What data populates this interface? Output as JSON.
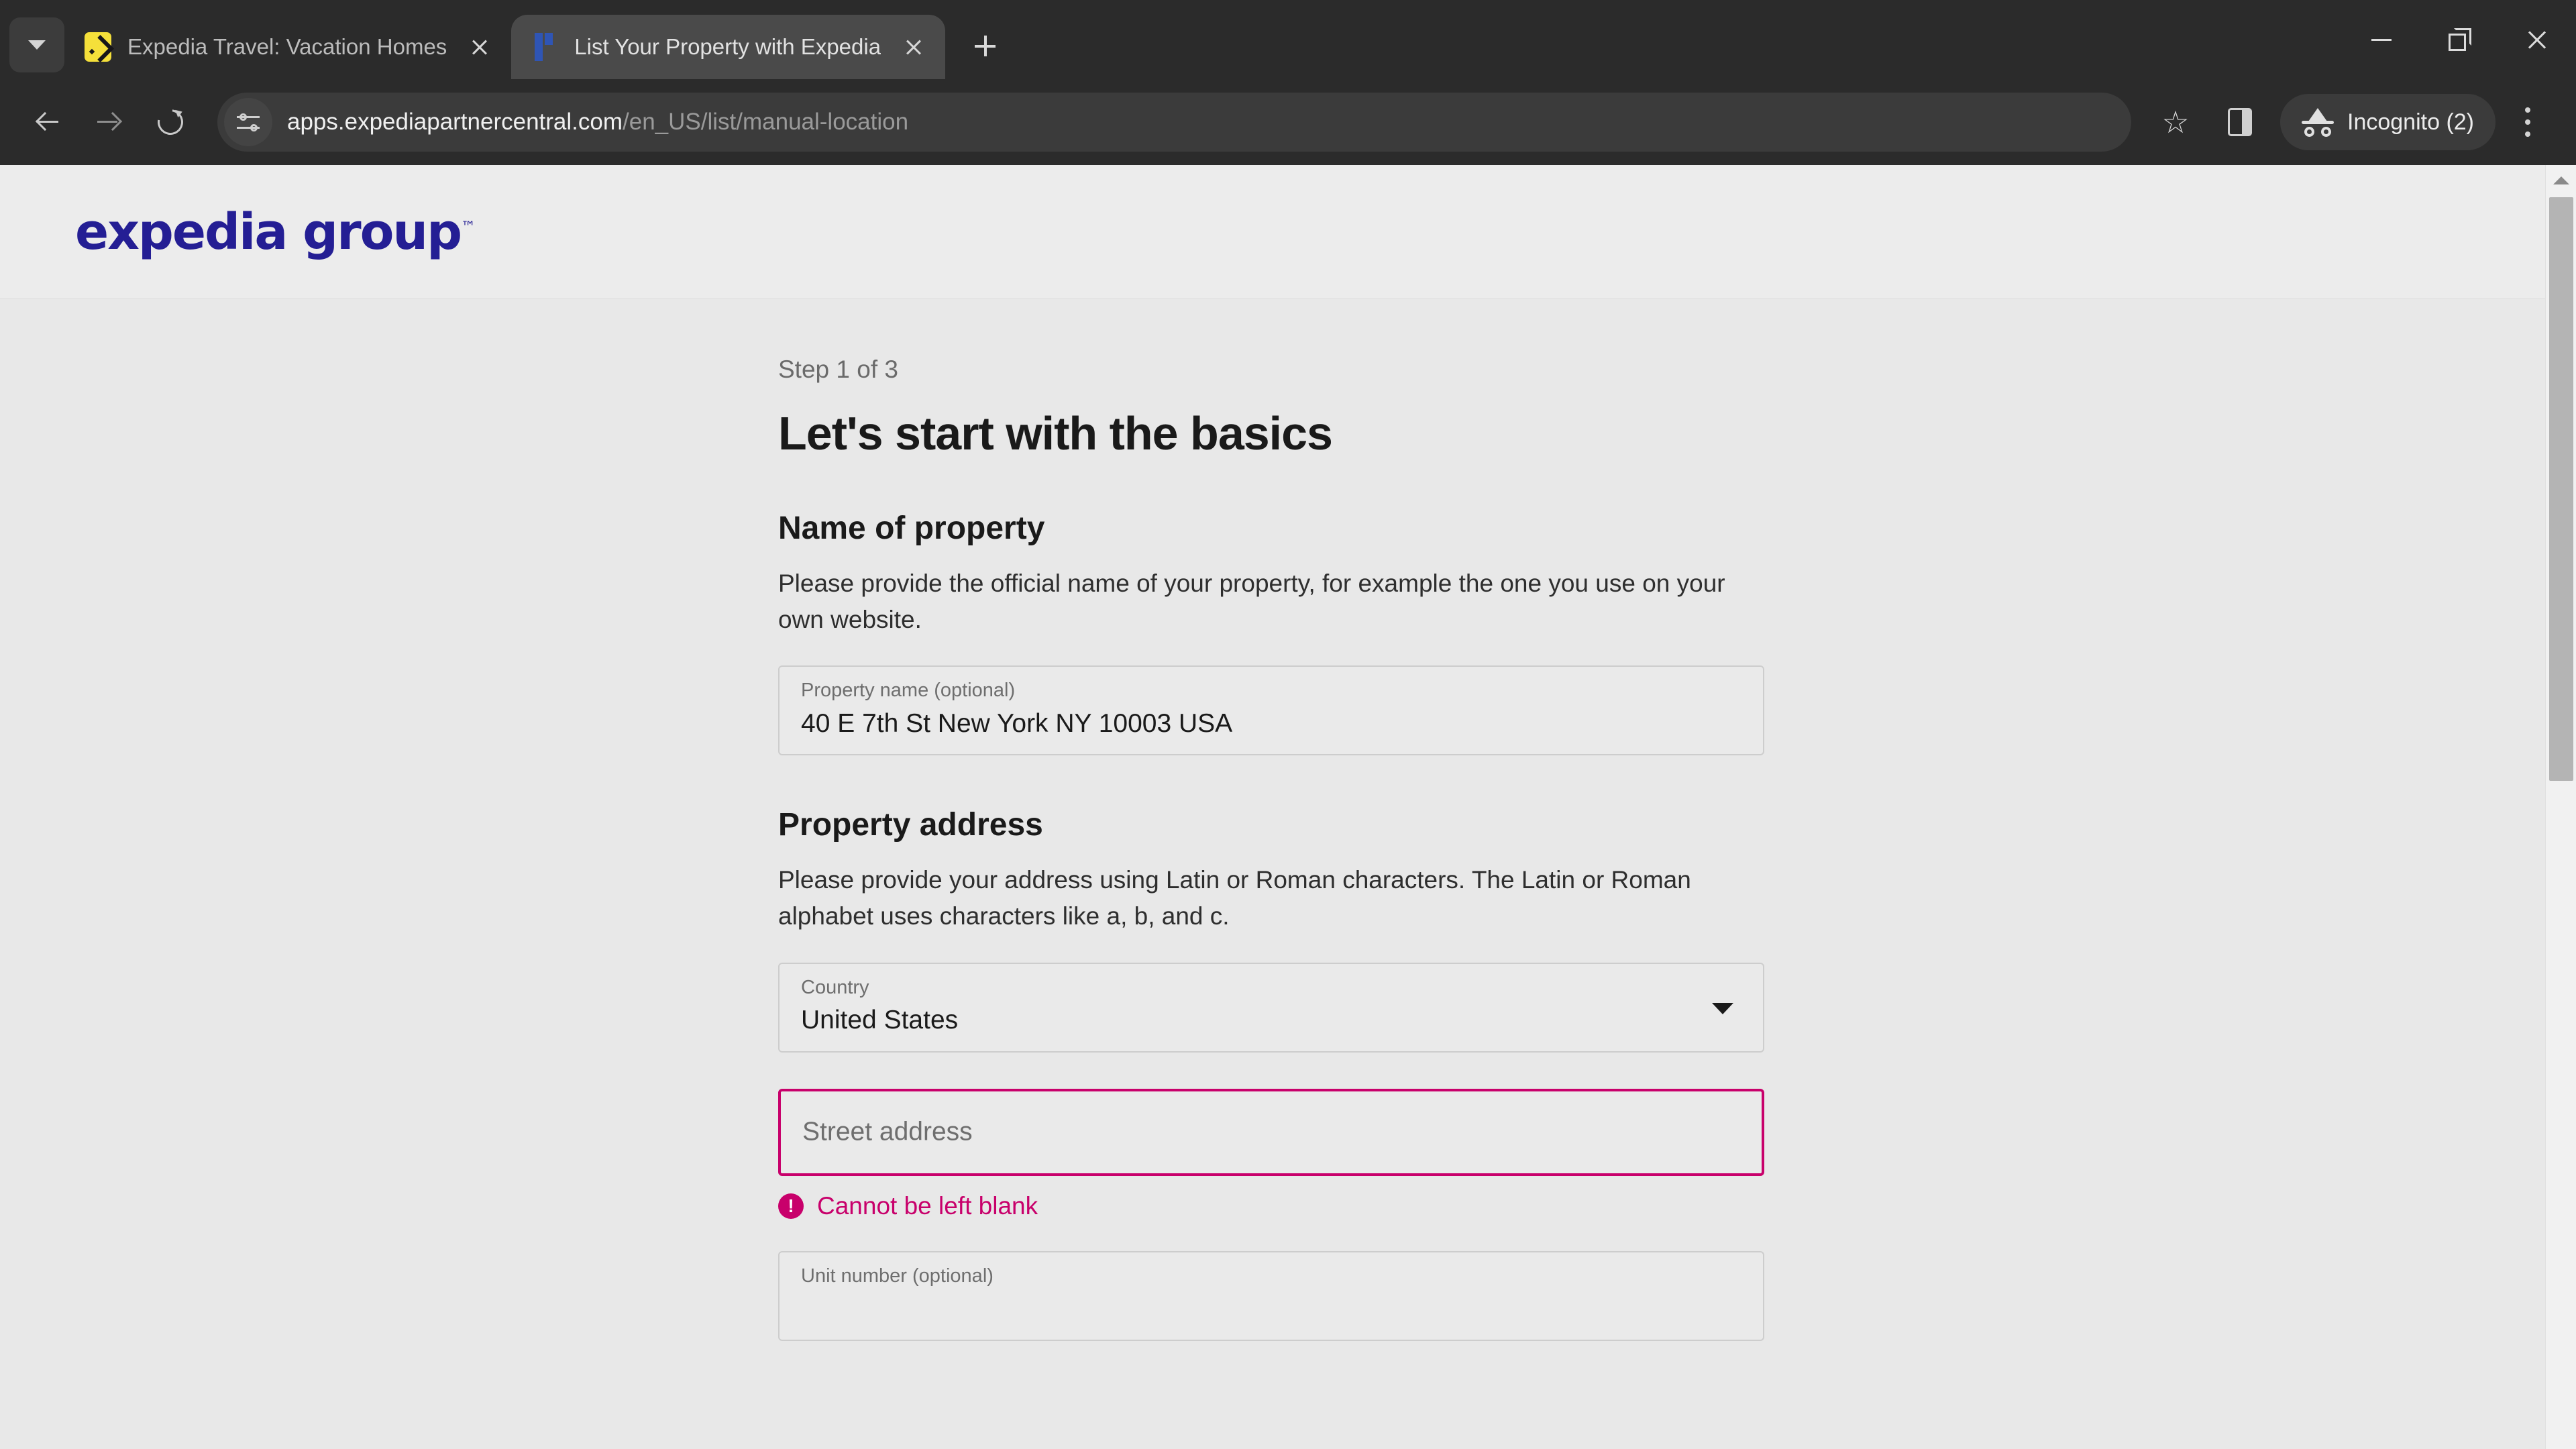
{
  "browser": {
    "tab_list_icon": "chevron-down-icon",
    "tabs": [
      {
        "title": "Expedia Travel: Vacation Homes",
        "favicon": "expedia-favicon",
        "active": false,
        "close_icon": "close-icon"
      },
      {
        "title": "List Your Property with Expedia",
        "favicon": "expedia-partner-central-favicon",
        "active": true,
        "close_icon": "close-icon"
      }
    ],
    "new_tab_icon": "plus-icon",
    "window_controls": {
      "minimize": "minimize-icon",
      "maximize": "restore-icon",
      "close": "close-icon"
    },
    "toolbar": {
      "back_icon": "arrow-left-icon",
      "forward_icon": "arrow-right-icon",
      "reload_icon": "reload-icon",
      "site_info_icon": "site-settings-sliders-icon",
      "url_host": "apps.expediapartnercentral.com",
      "url_path": "/en_US/list/manual-location",
      "url_full": "apps.expediapartnercentral.com/en_US/list/manual-location",
      "bookmark_icon": "star-icon",
      "side_panel_icon": "side-panel-icon",
      "incognito_icon": "incognito-spy-icon",
      "incognito_label": "Incognito (2)",
      "menu_icon": "kebab-menu-icon"
    }
  },
  "page": {
    "brand": "expedia group",
    "brand_tm": "™",
    "step_label": "Step 1 of 3",
    "title": "Let's start with the basics",
    "sections": [
      {
        "heading": "Name of property",
        "description": "Please provide the official name of your property, for example the one you use on your own website."
      },
      {
        "heading": "Property address",
        "description": "Please provide your address using Latin or Roman characters. The Latin or Roman alphabet uses characters like a, b, and c."
      }
    ],
    "fields": {
      "property_name": {
        "label": "Property name (optional)",
        "value": "40 E 7th St New York NY 10003 USA"
      },
      "country": {
        "label": "Country",
        "value": "United States",
        "caret_icon": "chevron-down-icon"
      },
      "street_address": {
        "placeholder": "Street address",
        "value": "",
        "error": "Cannot be left blank",
        "error_icon": "error-exclamation-icon"
      },
      "unit_number": {
        "label": "Unit number (optional)",
        "value": ""
      }
    },
    "colors": {
      "brand": "#241e94",
      "error": "#c8006b",
      "page_background": "#e8e8e8",
      "header_background": "#ececec"
    }
  }
}
